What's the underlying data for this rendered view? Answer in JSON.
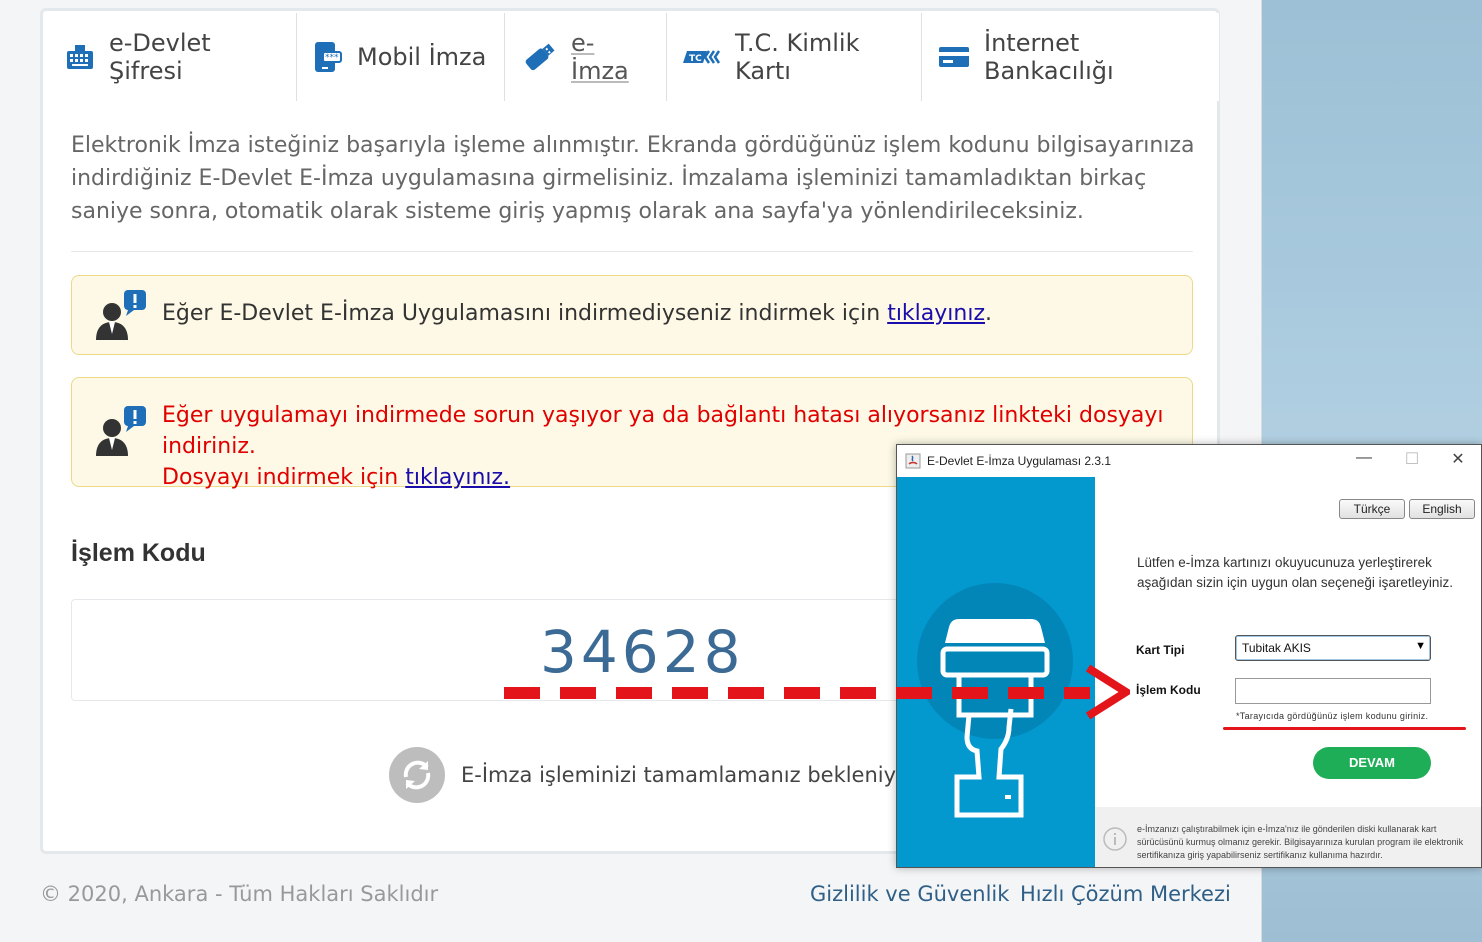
{
  "tabs": [
    {
      "label": "e-Devlet Şifresi",
      "icon": "keypad-icon"
    },
    {
      "label": "Mobil İmza",
      "icon": "mobile-signature-icon"
    },
    {
      "label": "e-İmza",
      "icon": "usb-token-icon"
    },
    {
      "label": "T.C. Kimlik Kartı",
      "icon": "tc-id-card-icon"
    },
    {
      "label": "İnternet Bankacılığı",
      "icon": "bank-card-icon"
    }
  ],
  "intro": "Elektronik İmza isteğiniz başarıyla işleme alınmıştır. Ekranda gördüğünüz işlem kodunu bilgisayarınıza indirdiğiniz E-Devlet E-İmza uygulamasına girmelisiniz. İmzalama işleminizi tamamladıktan birkaç saniye sonra, otomatik olarak sisteme giriş yapmış olarak ana sayfa'ya yönlendirileceksiniz.",
  "alert1": {
    "text": "Eğer E-Devlet E-İmza Uygulamasını indirmediyseniz indirmek için ",
    "link": "tıklayınız",
    "suffix": "."
  },
  "alert2": {
    "line1": "Eğer uygulamayı indirmede sorun yaşıyor ya da bağlantı hatası alıyorsanız linkteki dosyayı indiriniz.",
    "line2": "Dosyayı indirmek için ",
    "link": "tıklayınız."
  },
  "code": {
    "title": "İşlem Kodu",
    "value": "34628"
  },
  "waiting": "E-İmza işleminizi tamamlamanız bekleniyor...",
  "footer": {
    "copyright": "© 2020, Ankara - Tüm Hakları Saklıdır",
    "privacy": "Gizlilik ve Güvenlik",
    "help": "Hızlı Çözüm Merkezi"
  },
  "dialog": {
    "title": "E-Devlet E-İmza Uygulaması 2.3.1",
    "lang_tr": "Türkçe",
    "lang_en": "English",
    "instr_line1": "Lütfen e-İmza kartınızı okuyucunuza yerleştirerek",
    "instr_line2": "aşağıdan sizin için uygun olan seçeneği işaretleyiniz.",
    "kart_label": "Kart Tipi",
    "kart_value": "Tubitak AKIS",
    "kod_label": "İşlem Kodu",
    "kod_value": "",
    "hint": "*Tarayıcıda gördüğünüz işlem kodunu giriniz.",
    "devam": "DEVAM",
    "footnote": "e-İmzanızı çalıştırabilmek için e-İmza'nız ile gönderilen diski kullanarak kart sürücüsünü kurmuş olmanız gerekir. Bilgisayarınıza kurulan program ile elektronik sertifikanıza giriş yapabilirseniz sertifikanız kullanıma hazırdır."
  },
  "colors": {
    "accent_blue": "#0399cf",
    "code_blue": "#3b6a95",
    "error_red": "#e00000",
    "devam_green": "#1fae58"
  }
}
